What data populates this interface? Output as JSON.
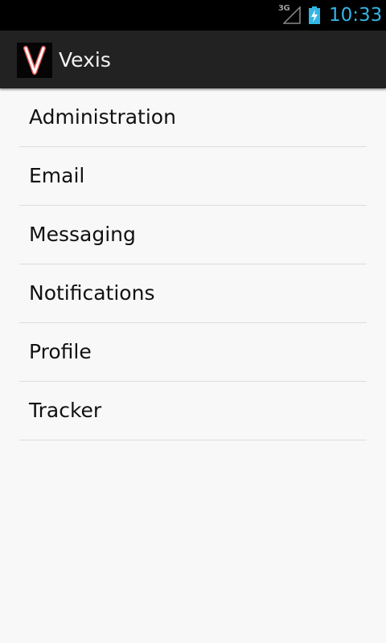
{
  "status_bar": {
    "network_type": "3G",
    "time": "10:33",
    "icons": [
      "signal-icon",
      "battery-icon"
    ],
    "clock_color": "#33b5e5"
  },
  "action_bar": {
    "app_icon": "v-logo-icon",
    "title": "Vexis"
  },
  "menu": {
    "items": [
      {
        "label": "Administration"
      },
      {
        "label": "Email"
      },
      {
        "label": "Messaging"
      },
      {
        "label": "Notifications"
      },
      {
        "label": "Profile"
      },
      {
        "label": "Tracker"
      }
    ]
  }
}
